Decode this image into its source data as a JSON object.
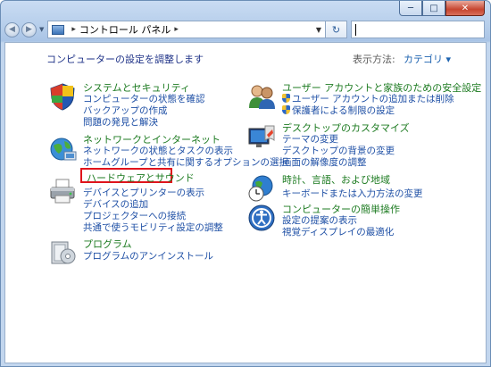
{
  "window": {
    "controls": {
      "minimize": "─",
      "maximize": "□",
      "close": "✕"
    }
  },
  "navigation": {
    "back_icon": "back-arrow-icon",
    "forward_icon": "forward-arrow-icon",
    "breadcrumb": [
      "コントロール パネル"
    ],
    "search_placeholder": ""
  },
  "header": {
    "heading": "コンピューターの設定を調整します",
    "view_by_label": "表示方法:",
    "view_by_value": "カテゴリ ▾"
  },
  "categories": [
    {
      "id": "system-security",
      "icon": "shield-flag-icon",
      "title": "システムとセキュリティ",
      "links": [
        "コンピューターの状態を確認",
        "バックアップの作成",
        "問題の発見と解決"
      ]
    },
    {
      "id": "network-internet",
      "icon": "network-globe-icon",
      "title": "ネットワークとインターネット",
      "links": [
        "ネットワークの状態とタスクの表示",
        "ホームグループと共有に関するオプションの選択"
      ]
    },
    {
      "id": "hardware-sound",
      "icon": "printer-icon",
      "title": "ハードウェアとサウンド",
      "links": [
        "デバイスとプリンターの表示",
        "デバイスの追加",
        "プロジェクターへの接続",
        "共通で使うモビリティ設定の調整"
      ]
    },
    {
      "id": "programs",
      "icon": "programs-icon",
      "title": "プログラム",
      "links": [
        "プログラムのアンインストール"
      ]
    },
    {
      "id": "user-accounts",
      "icon": "users-icon",
      "title": "ユーザー アカウントと家族のための安全設定",
      "links": [
        "ユーザー アカウントの追加または削除",
        "保護者による制限の設定"
      ]
    },
    {
      "id": "appearance",
      "icon": "display-icon",
      "title": "デスクトップのカスタマイズ",
      "links": [
        "テーマの変更",
        "デスクトップの背景の変更",
        "画面の解像度の調整"
      ]
    },
    {
      "id": "clock-region",
      "icon": "clock-globe-icon",
      "title": "時計、言語、および地域",
      "links": [
        "キーボードまたは入力方法の変更"
      ]
    },
    {
      "id": "ease-of-access",
      "icon": "ease-of-access-icon",
      "title": "コンピューターの簡単操作",
      "links": [
        "設定の提案の表示",
        "視覚ディスプレイの最適化"
      ]
    }
  ]
}
